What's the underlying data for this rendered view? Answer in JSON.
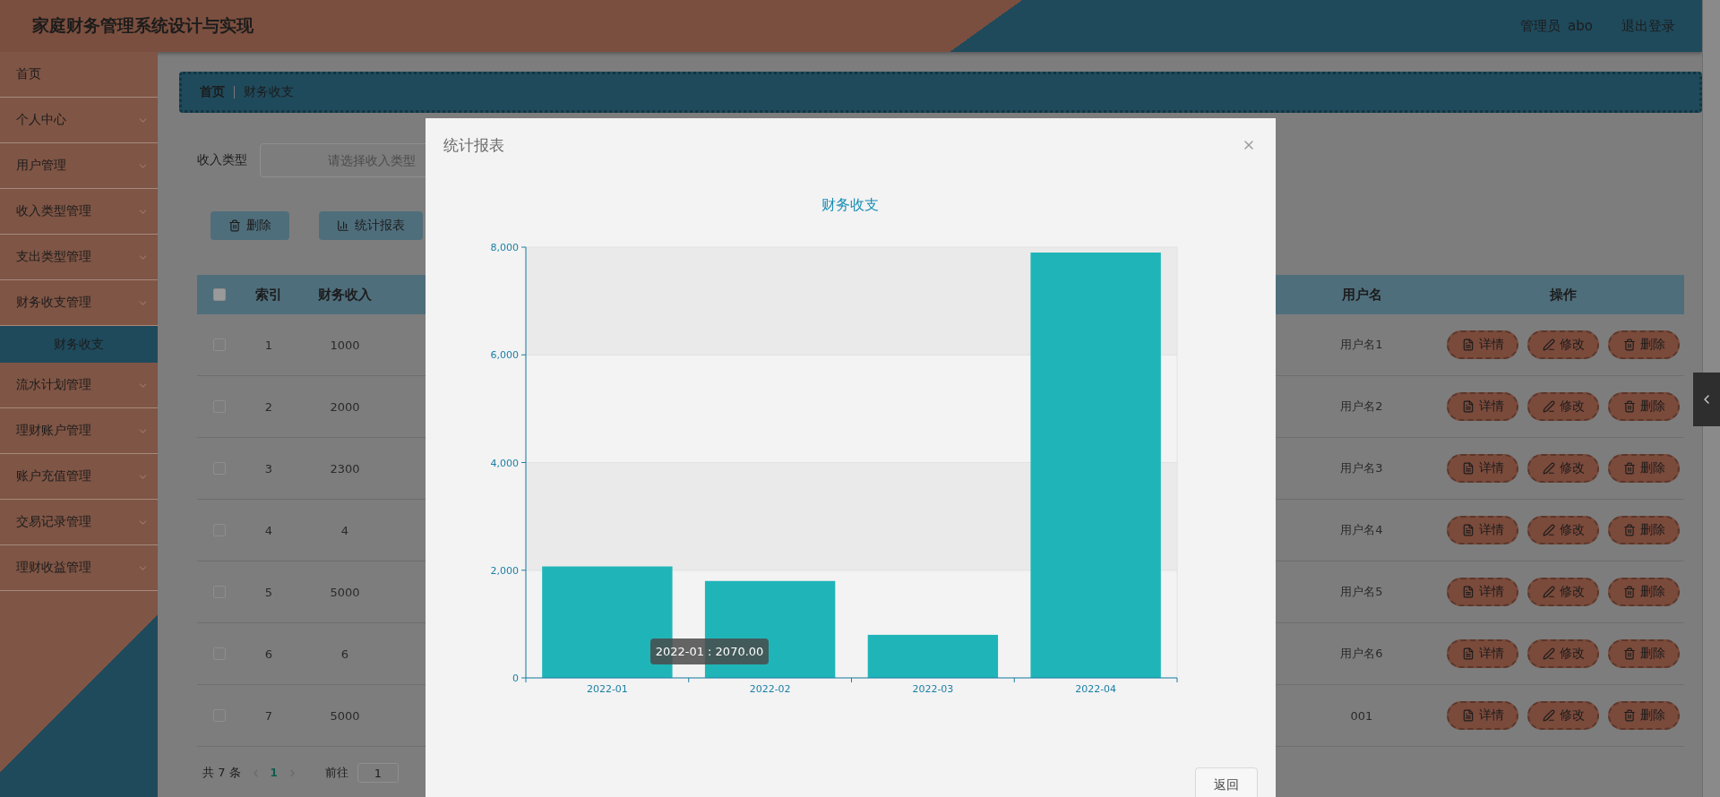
{
  "header": {
    "title": "家庭财务管理系统设计与实现",
    "user_role": "管理员",
    "username": "abo",
    "logout": "退出登录"
  },
  "sidebar": {
    "items": [
      {
        "label": "首页",
        "kind": "link"
      },
      {
        "label": "个人中心",
        "kind": "menu"
      },
      {
        "label": "用户管理",
        "kind": "menu"
      },
      {
        "label": "收入类型管理",
        "kind": "menu"
      },
      {
        "label": "支出类型管理",
        "kind": "menu"
      },
      {
        "label": "财务收支管理",
        "kind": "menu",
        "children": [
          {
            "label": "财务收支",
            "selected": true
          }
        ]
      },
      {
        "label": "流水计划管理",
        "kind": "menu"
      },
      {
        "label": "理财账户管理",
        "kind": "menu"
      },
      {
        "label": "账户充值管理",
        "kind": "menu"
      },
      {
        "label": "交易记录管理",
        "kind": "menu"
      },
      {
        "label": "理财收益管理",
        "kind": "menu"
      }
    ]
  },
  "breadcrumb": [
    "首页",
    "财务收支"
  ],
  "filter": {
    "label": "收入类型",
    "placeholder": "请选择收入类型"
  },
  "toolbar": [
    {
      "label": "删除",
      "kind": "delete"
    },
    {
      "label": "统计报表",
      "kind": "report"
    }
  ],
  "table": {
    "select_all_checked": false,
    "columns": [
      "索引",
      "财务收入",
      "用户名",
      "操作"
    ],
    "rows": [
      {
        "checked": false,
        "index": "1",
        "income": "1000",
        "username": "用户名1",
        "actions": [
          "详情",
          "修改",
          "删除"
        ]
      },
      {
        "checked": false,
        "index": "2",
        "income": "2000",
        "username": "用户名2",
        "actions": [
          "详情",
          "修改",
          "删除"
        ]
      },
      {
        "checked": false,
        "index": "3",
        "income": "2300",
        "username": "用户名3",
        "actions": [
          "详情",
          "修改",
          "删除"
        ]
      },
      {
        "checked": false,
        "index": "4",
        "income": "4",
        "username": "用户名4",
        "actions": [
          "详情",
          "修改",
          "删除"
        ]
      },
      {
        "checked": false,
        "index": "5",
        "income": "5000",
        "username": "用户名5",
        "actions": [
          "详情",
          "修改",
          "删除"
        ]
      },
      {
        "checked": false,
        "index": "6",
        "income": "6",
        "username": "用户名6",
        "actions": [
          "详情",
          "修改",
          "删除"
        ]
      },
      {
        "checked": false,
        "index": "7",
        "income": "5000",
        "username": "001",
        "actions": [
          "详情",
          "修改",
          "删除"
        ]
      }
    ]
  },
  "pagination": {
    "total_prefix": "共",
    "total": "7",
    "total_suffix": "条",
    "current_page": "1",
    "goto_label": "前往",
    "goto_value": "1"
  },
  "modal": {
    "title": "统计报表",
    "button": "返回",
    "tooltip": "2022-01 : 2070.00",
    "chart_data": {
      "type": "bar",
      "title": "财务收支",
      "categories": [
        "2022-01",
        "2022-02",
        "2022-03",
        "2022-04"
      ],
      "series": [
        {
          "color": "#1fb5b8",
          "values": [
            2070,
            1800,
            800,
            7900
          ]
        }
      ],
      "ylim": [
        0,
        8000
      ],
      "yticks": [
        0,
        {
          "value": 2000,
          "label": "2,000"
        },
        {
          "value": 4000,
          "label": "4,000"
        },
        {
          "value": 6000,
          "label": "6,000"
        },
        {
          "value": 8000,
          "label": "8,000"
        }
      ]
    }
  }
}
